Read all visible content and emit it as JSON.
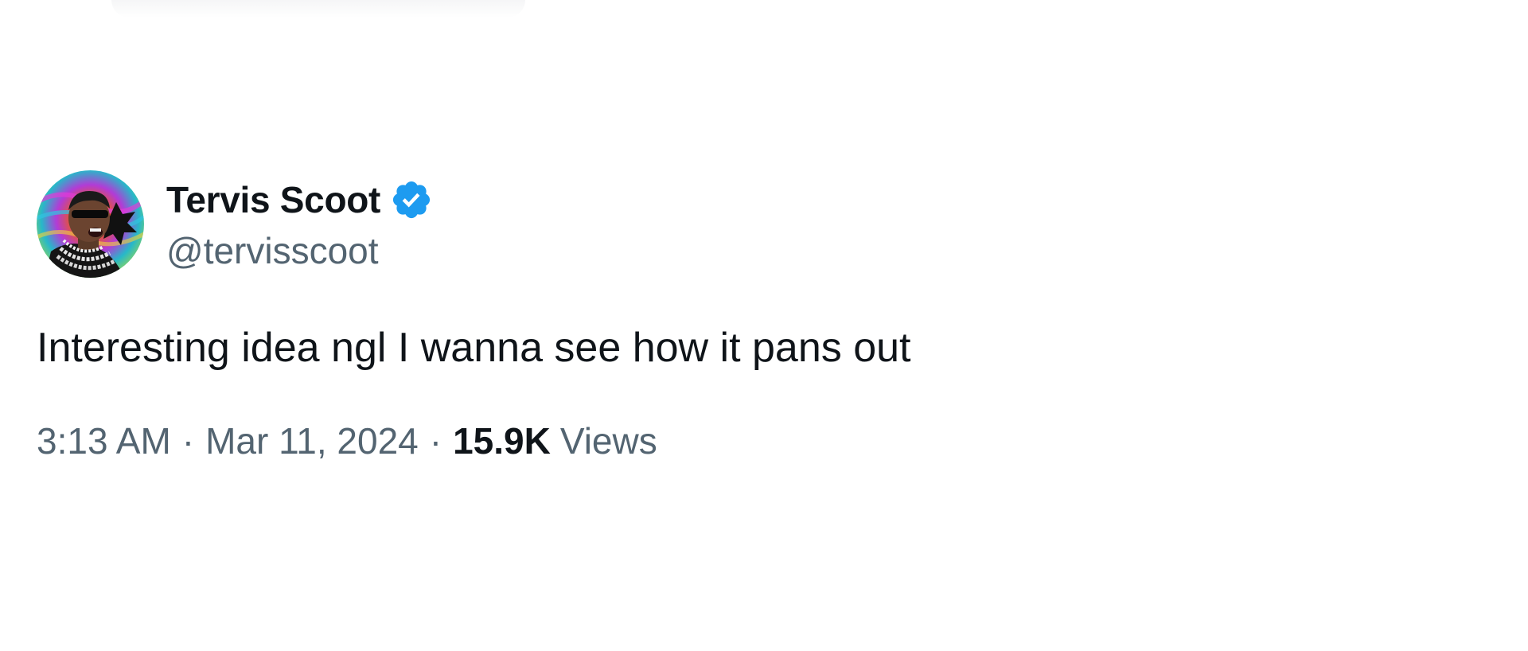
{
  "tweet": {
    "author": {
      "display_name": "Tervis Scoot",
      "handle": "@tervisscoot",
      "verified": true,
      "verified_icon": "verified-badge-icon",
      "avatar_icon": "avatar-image"
    },
    "text": "Interesting idea ngl I wanna see how it pans out",
    "meta": {
      "time": "3:13 AM",
      "separator": "·",
      "date": "Mar 11, 2024",
      "views_count": "15.9K",
      "views_label": "Views"
    }
  },
  "colors": {
    "primary_text": "#0f1419",
    "secondary_text": "#536471",
    "verified_blue": "#1d9bf0",
    "background": "#ffffff"
  }
}
